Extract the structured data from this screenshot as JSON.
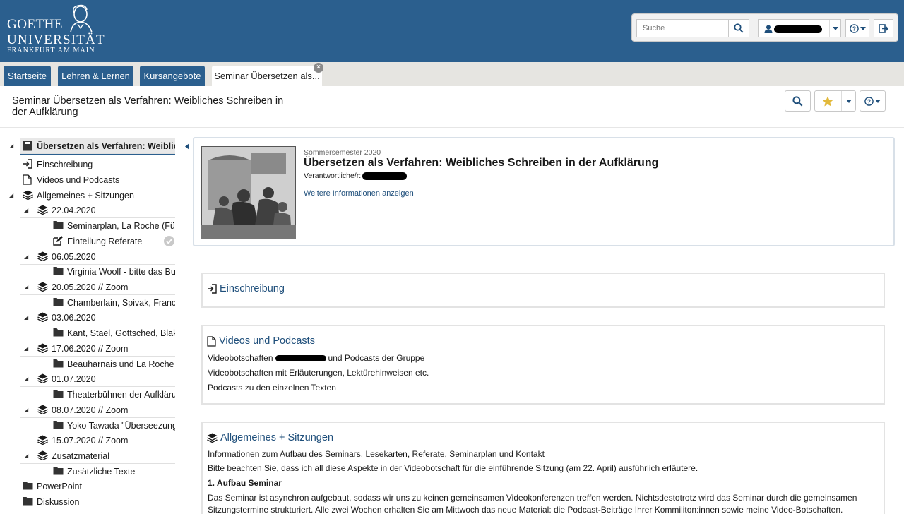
{
  "header": {
    "logo": {
      "line1": "GOETHE",
      "line2": "UNIVERSITÄT",
      "line3": "FRANKFURT AM MAIN"
    },
    "search_placeholder": "Suche",
    "brand_color": "#2b5f8e"
  },
  "tabs": [
    {
      "label": "Startseite"
    },
    {
      "label": "Lehren & Lernen"
    },
    {
      "label": "Kursangebote"
    },
    {
      "label": "Seminar Übersetzen als..."
    }
  ],
  "page": {
    "title": "Seminar Übersetzen als Verfahren: Weibliches Schreiben in der Aufklärung"
  },
  "tree": [
    {
      "label": "Übersetzen als Verfahren: Weiblich",
      "icon": "book-icon"
    },
    {
      "label": "Einschreibung",
      "icon": "sign-in-icon"
    },
    {
      "label": "Videos und Podcasts",
      "icon": "file-icon"
    },
    {
      "label": "Allgemeines + Sitzungen",
      "icon": "layers-icon"
    },
    {
      "label": "22.04.2020",
      "icon": "layers-icon"
    },
    {
      "label": "Seminarplan, La Roche (Für",
      "icon": "folder-icon"
    },
    {
      "label": "Einteilung Referate",
      "icon": "edit-icon"
    },
    {
      "label": "06.05.2020",
      "icon": "layers-icon"
    },
    {
      "label": "Virginia Woolf - bitte das Buc",
      "icon": "folder-icon"
    },
    {
      "label": "20.05.2020 // Zoom",
      "icon": "layers-icon"
    },
    {
      "label": "Chamberlain, Spivak, Franck",
      "icon": "folder-icon"
    },
    {
      "label": "03.06.2020",
      "icon": "layers-icon"
    },
    {
      "label": "Kant, Stael, Gottsched, Blake",
      "icon": "folder-icon"
    },
    {
      "label": "17.06.2020 // Zoom",
      "icon": "layers-icon"
    },
    {
      "label": "Beauharnais und La Roche",
      "icon": "folder-icon"
    },
    {
      "label": "01.07.2020",
      "icon": "layers-icon"
    },
    {
      "label": "Theaterbühnen der Aufklärun",
      "icon": "folder-icon"
    },
    {
      "label": "08.07.2020 // Zoom",
      "icon": "layers-icon"
    },
    {
      "label": "Yoko Tawada \"Überseezunge",
      "icon": "folder-icon"
    },
    {
      "label": "15.07.2020 // Zoom",
      "icon": "layers-icon"
    },
    {
      "label": "Zusatzmaterial",
      "icon": "layers-icon"
    },
    {
      "label": "Zusätzliche Texte",
      "icon": "folder-icon"
    },
    {
      "label": "PowerPoint",
      "icon": "folder-icon"
    },
    {
      "label": "Diskussion",
      "icon": "folder-icon"
    }
  ],
  "course": {
    "semester": "Sommersemester 2020",
    "title": "Übersetzen als Verfahren: Weibliches Schreiben in der Aufklärung",
    "responsible_label": "Verantwortliche/r:",
    "more_info": "Weitere Informationen anzeigen"
  },
  "blocks": {
    "einschreibung": {
      "title": "Einschreibung"
    },
    "videos": {
      "title": "Videos und Podcasts",
      "line1_pre": "Videobotschaften",
      "line1_post": "und Podcasts der Gruppe",
      "line2": "Videobotschaften mit Erläuterungen, Lektürehinweisen etc.",
      "line3": "Podcasts zu den einzelnen Texten"
    },
    "allgemeines": {
      "title": "Allgemeines + Sitzungen",
      "line1": "Informationen zum Aufbau des Seminars, Lesekarten, Referate, Seminarplan und Kontakt",
      "line2": "Bitte beachten Sie, dass ich all diese Aspekte in der Videobotschaft für die einführende Sitzung (am 22. April) ausführlich erläutere.",
      "heading": "1. Aufbau Seminar",
      "line3": "Das Seminar ist asynchron aufgebaut, sodass wir uns zu keinen gemeinsamen Videokonferenzen treffen werden. Nichtsdestotrotz wird das Seminar durch die gemeinsamen",
      "line4": "Sitzungstermine strukturiert. Alle zwei Wochen erhalten Sie am Mittwoch das neue Material: die Podcast-Beiträge Ihrer Kommiliton:innen sowie meine Video-Botschaften."
    }
  }
}
